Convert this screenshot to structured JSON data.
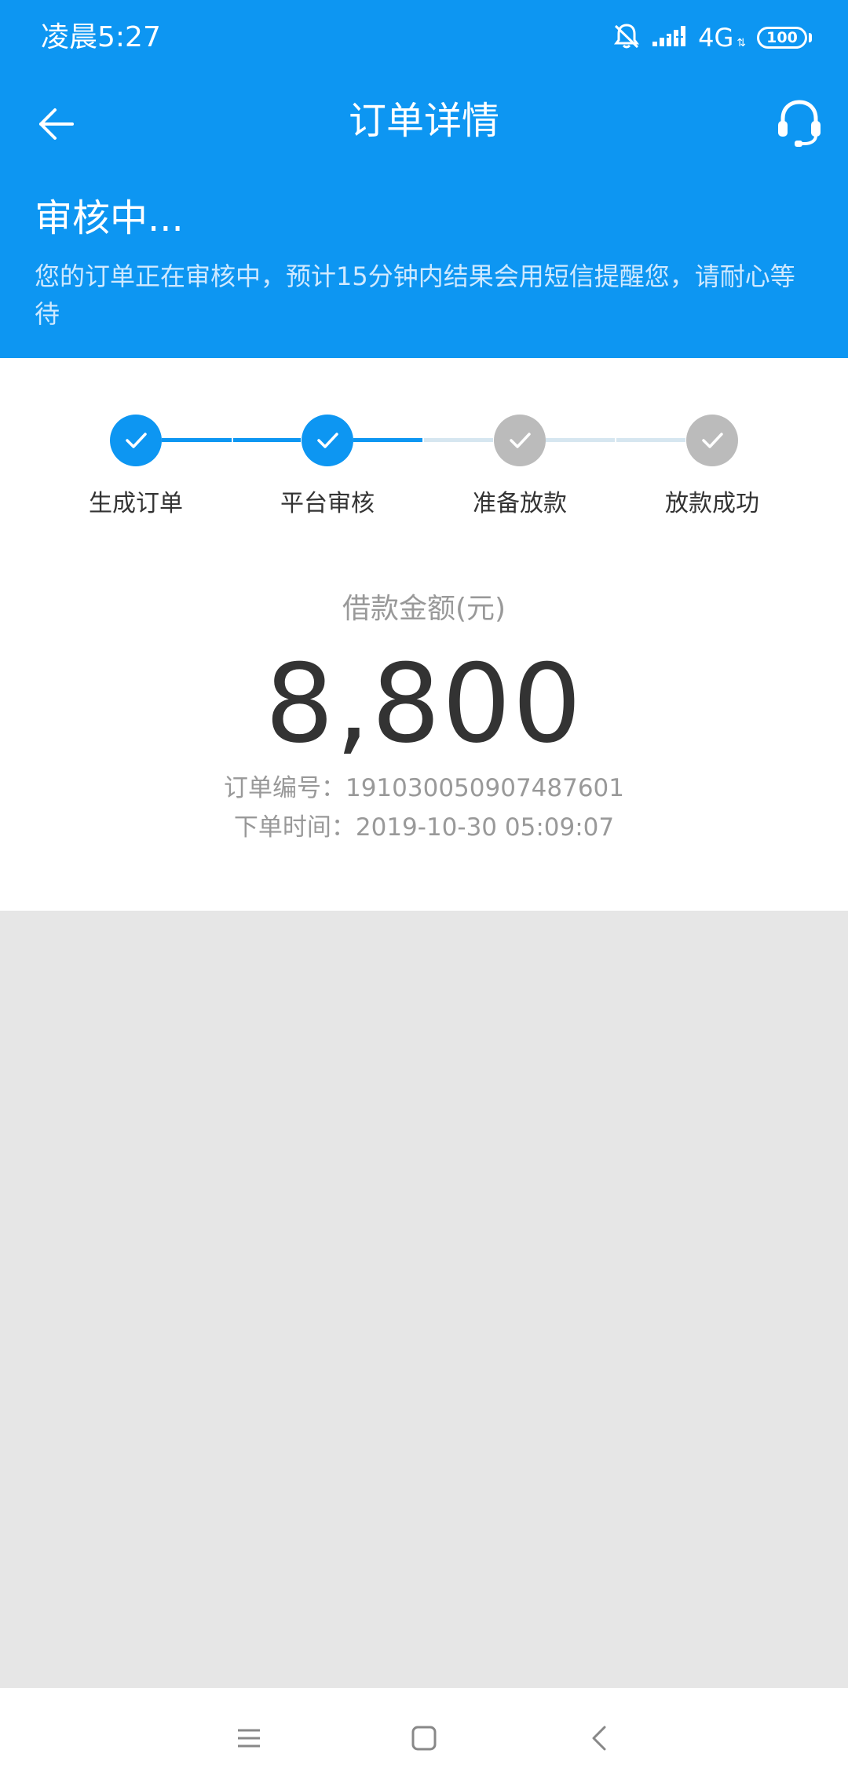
{
  "status_bar": {
    "time": "凌晨5:27",
    "network": "4G",
    "network_sub": "⇅",
    "battery": "100",
    "icons": [
      "alarm-off-icon",
      "signal-icon"
    ]
  },
  "nav": {
    "title": "订单详情",
    "back_icon": "arrow-left-icon",
    "support_icon": "headset-icon"
  },
  "review": {
    "title": "审核中...",
    "description": "您的订单正在审核中，预计15分钟内结果会用短信提醒您，请耐心等待"
  },
  "steps": [
    {
      "label": "生成订单",
      "done": true
    },
    {
      "label": "平台审核",
      "done": true
    },
    {
      "label": "准备放款",
      "done": false
    },
    {
      "label": "放款成功",
      "done": false
    }
  ],
  "loan": {
    "caption": "借款金额(元)",
    "amount": "8,800"
  },
  "order": {
    "number_line": "订单编号：191030050907487601",
    "time_line": "下单时间：2019-10-30 05:09:07"
  },
  "colors": {
    "primary": "#0d96f2",
    "inactive_step": "#bbbbbb",
    "inactive_line": "#d6e6f0",
    "background": "#e6e6e6"
  }
}
